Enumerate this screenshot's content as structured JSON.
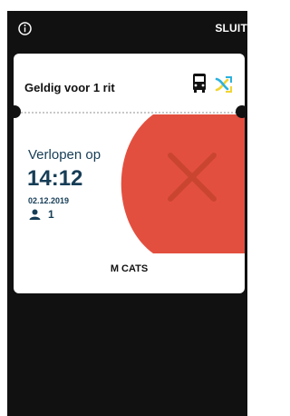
{
  "topbar": {
    "info_icon": "info-circle-icon",
    "close_label": "SLUIT"
  },
  "ticket": {
    "title": "Geldig voor 1 rit",
    "icons": [
      "bus-icon",
      "transfer-icon"
    ],
    "expires_label": "Verlopen op",
    "expires_time": "14:12",
    "expires_date": "02.12.2019",
    "passengers": "1",
    "operator": "M CATS"
  },
  "colors": {
    "background": "#111111",
    "card": "#ffffff",
    "expired_red": "#e34f3f",
    "expired_x": "#c9452f",
    "text_navy": "#163d56",
    "transfer_yellow": "#f1d531",
    "transfer_blue": "#2ab1de"
  }
}
